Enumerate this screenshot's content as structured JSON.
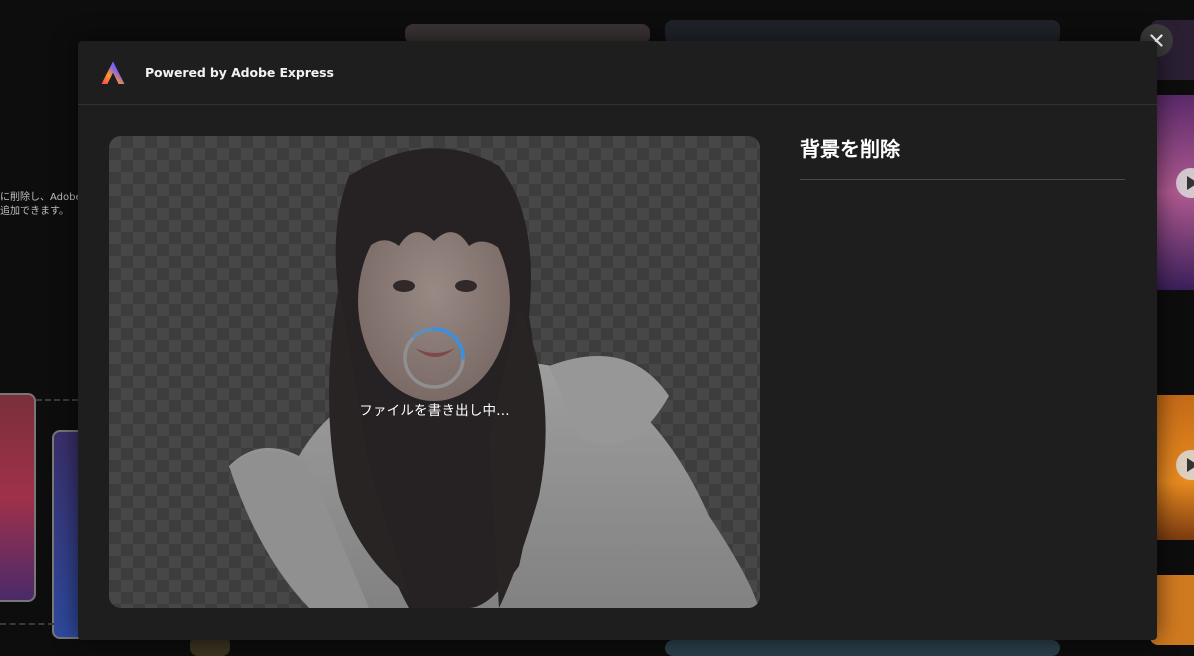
{
  "background_page": {
    "caption_line_1": "に削除し、Adobe",
    "caption_line_2": "追加できます。"
  },
  "modal": {
    "brand_text": "Powered by Adobe Express",
    "preview_status": "ファイルを書き出し中...",
    "panel_title": "背景を削除",
    "close_label": "×"
  },
  "icons": {
    "brand": "adobe-express-logo",
    "loading": "spinner-icon",
    "close": "close-icon",
    "play": "play-icon"
  },
  "colors": {
    "modal_bg": "#1e1e1e",
    "page_bg": "#0d0d0d",
    "spinner_accent": "#3a8fe0",
    "text_primary": "#ffffff"
  }
}
